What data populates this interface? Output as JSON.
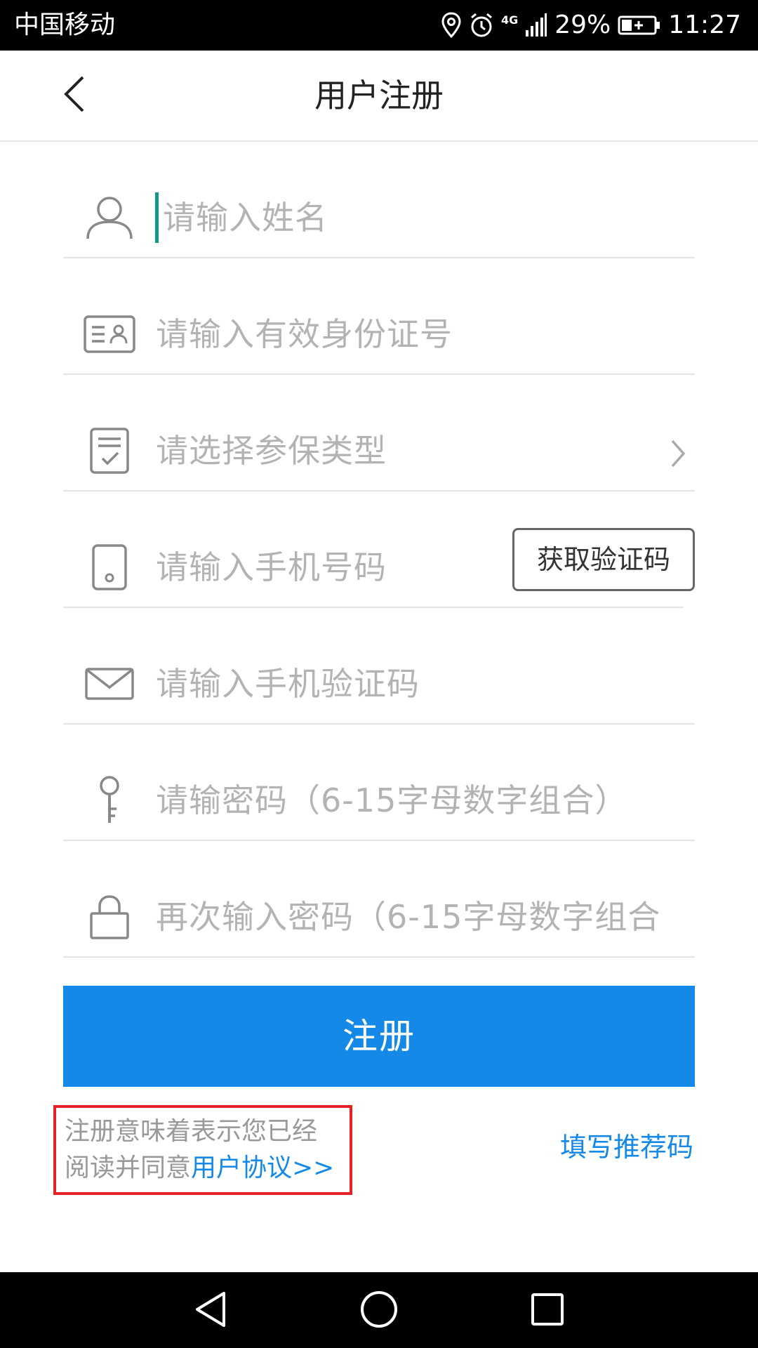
{
  "status_bar": {
    "carrier": "中国移动",
    "network": "4G",
    "battery": "29%",
    "time": "11:27",
    "icons": [
      "location-icon",
      "alarm-icon",
      "signal-icon",
      "battery-icon"
    ]
  },
  "header": {
    "title": "用户注册",
    "back_icon": "back-arrow-icon"
  },
  "form": {
    "name_placeholder": "请输入姓名",
    "id_placeholder": "请输入有效身份证号",
    "insurance_placeholder": "请选择参保类型",
    "phone_placeholder": "请输入手机号码",
    "get_code_label": "获取验证码",
    "sms_code_placeholder": "请输入手机验证码",
    "password_placeholder": "请输密码（6-15字母数字组合）",
    "confirm_password_placeholder": "再次输入密码（6-15字母数字组合"
  },
  "actions": {
    "register_label": "注册",
    "agreement_line1": "注册意味着表示您已经",
    "agreement_line2": "阅读并同意",
    "agreement_link": "用户协议>>",
    "referral_label": "填写推荐码"
  },
  "colors": {
    "accent": "#1589e8",
    "cursor": "#12998c",
    "highlight_border": "#e52226"
  },
  "nav": {
    "icons": [
      "nav-back-icon",
      "nav-home-icon",
      "nav-recents-icon"
    ]
  }
}
